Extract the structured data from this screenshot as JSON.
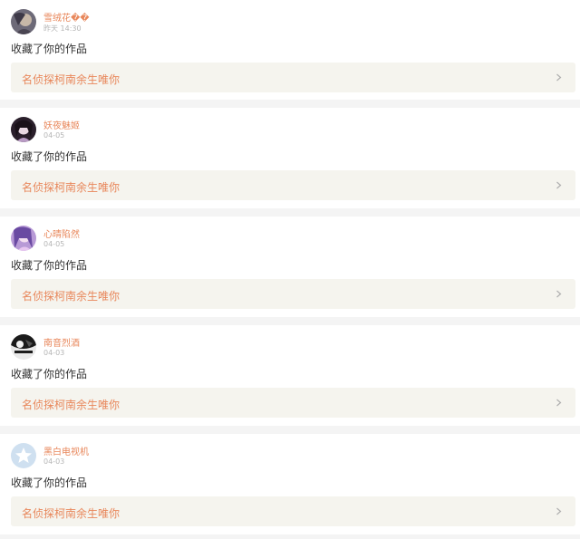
{
  "feed": [
    {
      "user": "雪绒花��",
      "time": "昨天 14:30",
      "action": "收藏了你的作品",
      "work_title": "名侦探柯南余生唯你",
      "avatar": "avatar-portrait-icon",
      "avatar_colors": [
        "#6d6a78",
        "#c7b8a8"
      ]
    },
    {
      "user": "妖夜魅姬",
      "time": "04-05",
      "action": "收藏了你的作品",
      "work_title": "名侦探柯南余生唯你",
      "avatar": "avatar-portrait-icon",
      "avatar_colors": [
        "#2a1f2b",
        "#b99bc4"
      ]
    },
    {
      "user": "心晴陷然",
      "time": "04-05",
      "action": "收藏了你的作品",
      "work_title": "名侦探柯南余生唯你",
      "avatar": "avatar-portrait-icon",
      "avatar_colors": [
        "#6a4aa2",
        "#e7c6f0"
      ]
    },
    {
      "user": "南音烈酒",
      "time": "04-03",
      "action": "收藏了你的作品",
      "work_title": "名侦探柯南余生唯你",
      "avatar": "avatar-portrait-icon",
      "avatar_colors": [
        "#1b1b1b",
        "#e9e9e9"
      ]
    },
    {
      "user": "黑白电视机",
      "time": "04-03",
      "action": "收藏了你的作品",
      "work_title": "名侦探柯南余生唯你",
      "avatar": "default-avatar-star-icon",
      "avatar_colors": [
        "#cfe0f0",
        "#ffffff"
      ]
    }
  ],
  "colors": {
    "accent": "#e8875b",
    "page_bg": "#f4f4f4",
    "work_bg": "#f5f4ee",
    "time_text": "#b5b5b5",
    "body_text": "#333333",
    "chevron": "#b0b0b0"
  },
  "icons": {
    "chevron": "chevron-right-icon"
  }
}
